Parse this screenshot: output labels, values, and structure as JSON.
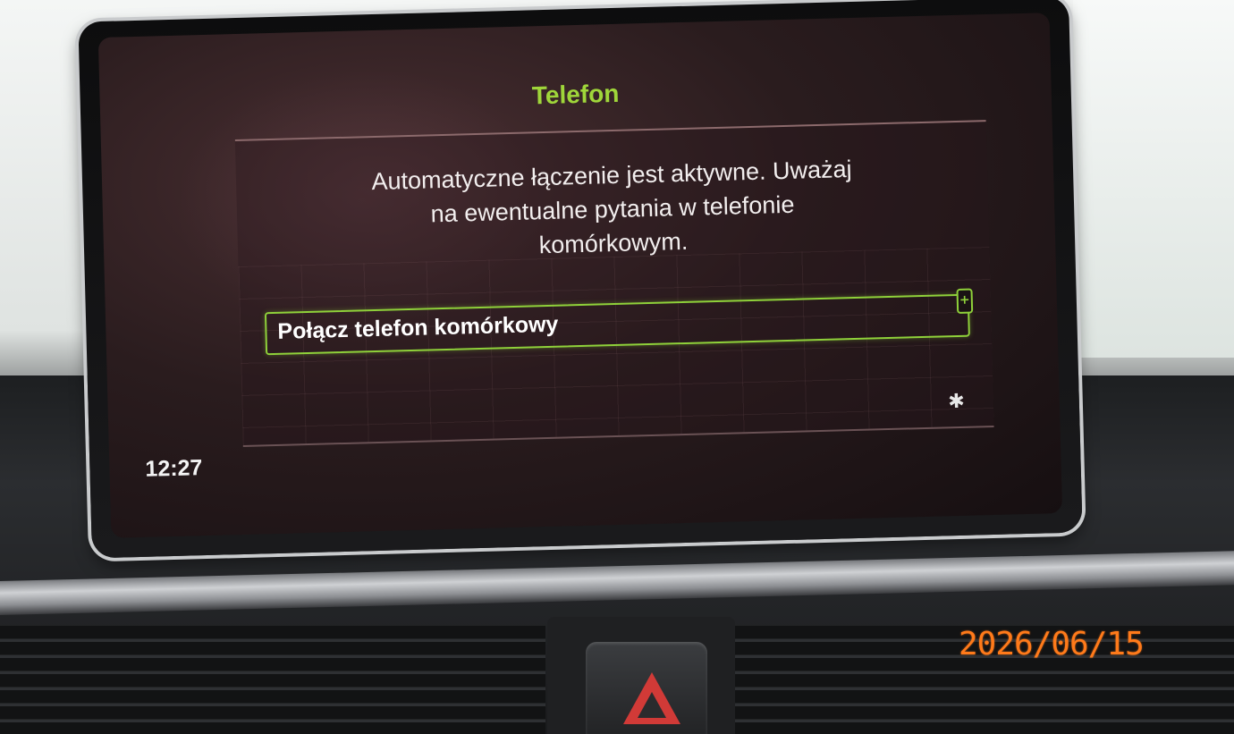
{
  "screen": {
    "title": "Telefon",
    "message": "Automatyczne łączenie jest aktywne. Uważaj\nna ewentualne pytania w telefonie\nkomórkowym.",
    "connect_label": "Połącz telefon komórkowy",
    "plus_symbol": "+",
    "clock": "12:27",
    "bluetooth_symbol": "✱"
  },
  "photo": {
    "date_stamp": "2026/06/15"
  },
  "colors": {
    "title_green": "#9fd63a",
    "highlight_green": "#8fd13a",
    "hazard_red": "#d13a37",
    "date_stamp_orange": "#ff7a1a"
  },
  "icons": [
    "bluetooth-icon",
    "plus-icon",
    "hazard-warning-icon"
  ]
}
